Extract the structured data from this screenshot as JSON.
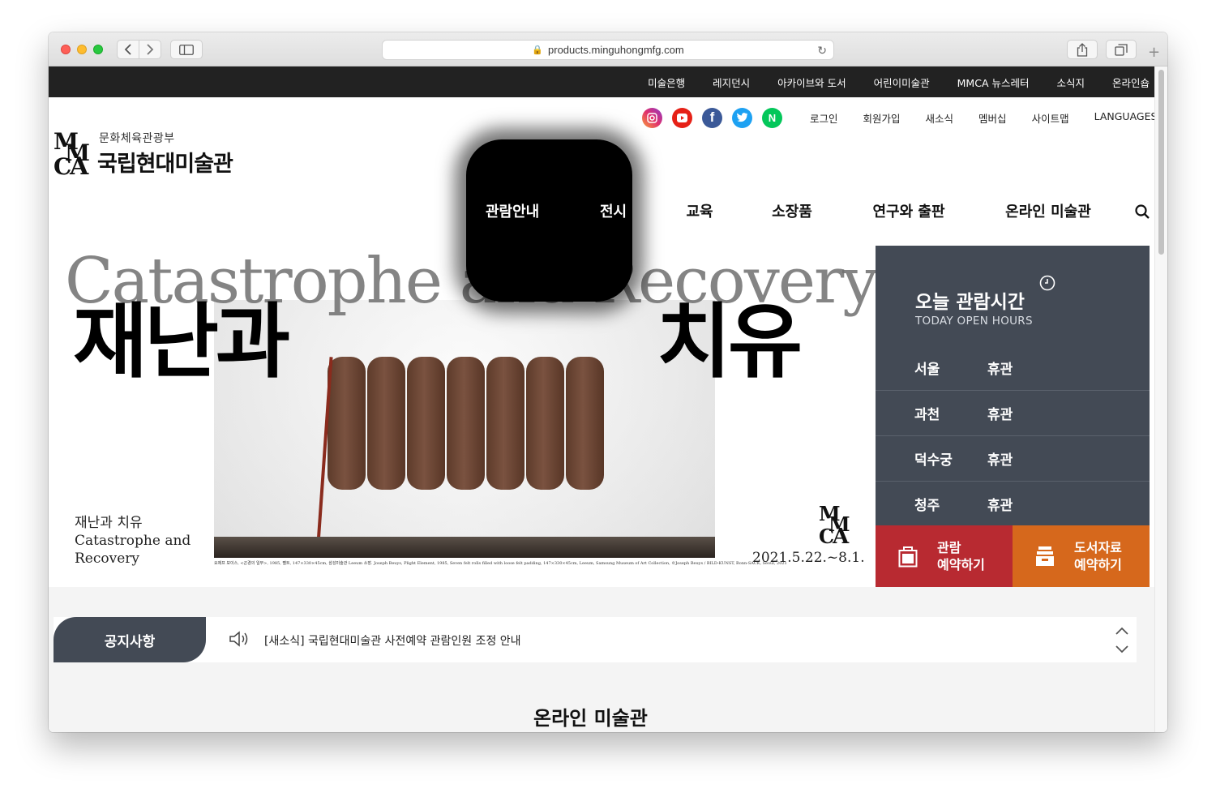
{
  "browser": {
    "url": "products.minguhongmfg.com"
  },
  "top_menu": [
    "미술은행",
    "레지던시",
    "아카이브와 도서",
    "어린이미술관",
    "MMCA 뉴스레터",
    "소식지",
    "온라인숍"
  ],
  "utility_links": [
    "로그인",
    "회원가입",
    "새소식",
    "멤버십",
    "사이트맵",
    "LANGUAGES"
  ],
  "sns_icons": [
    "instagram-icon",
    "youtube-icon",
    "facebook-icon",
    "twitter-icon",
    "naver-icon"
  ],
  "logo": {
    "subtitle": "문화체육관광부",
    "title": "국립현대미술관",
    "mark": "MMCA"
  },
  "gnb": [
    "관람안내",
    "전시",
    "교육",
    "소장품",
    "연구와 출판",
    "온라인 미술관"
  ],
  "hero": {
    "title_en": "Catastrophe and Recovery",
    "title_ko_1": "재난과",
    "title_ko_2": "치유",
    "small_ko": "재난과 치유",
    "small_en_1": "Catastrophe and",
    "small_en_2": "Recovery",
    "date": "2021.5.22.~8.1.",
    "caption": "요제프 보이스, <곤경의 일부>, 1985, 펠트, 147×330×45cm, 삼성미술관 Leeum 소장. Joseph Beuys, Plight Element, 1985, Seven felt rolls filled with loose felt padding, 147×330×45cm, Leeum, Samsung Museum of Art Collection, ©Joseph Beuys / BILD-KUNST, Bonn-SACK, Seoul, 2021"
  },
  "hours": {
    "title": "오늘 관람시간",
    "subtitle": "TODAY OPEN HOURS",
    "rows": [
      {
        "city": "서울",
        "status": "휴관"
      },
      {
        "city": "과천",
        "status": "휴관"
      },
      {
        "city": "덕수궁",
        "status": "휴관"
      },
      {
        "city": "청주",
        "status": "휴관"
      }
    ]
  },
  "reserve": {
    "visit_line1": "관람",
    "visit_line2": "예약하기",
    "library_line1": "도서자료",
    "library_line2": "예약하기"
  },
  "notice": {
    "label": "공지사항",
    "text": "[새소식] 국립현대미술관 사전예약 관람인원 조정 안내"
  },
  "online_heading": "온라인 미술관",
  "colors": {
    "topbar": "#222222",
    "panel": "#434a55",
    "visit": "#b82a31",
    "library": "#d6681c"
  }
}
